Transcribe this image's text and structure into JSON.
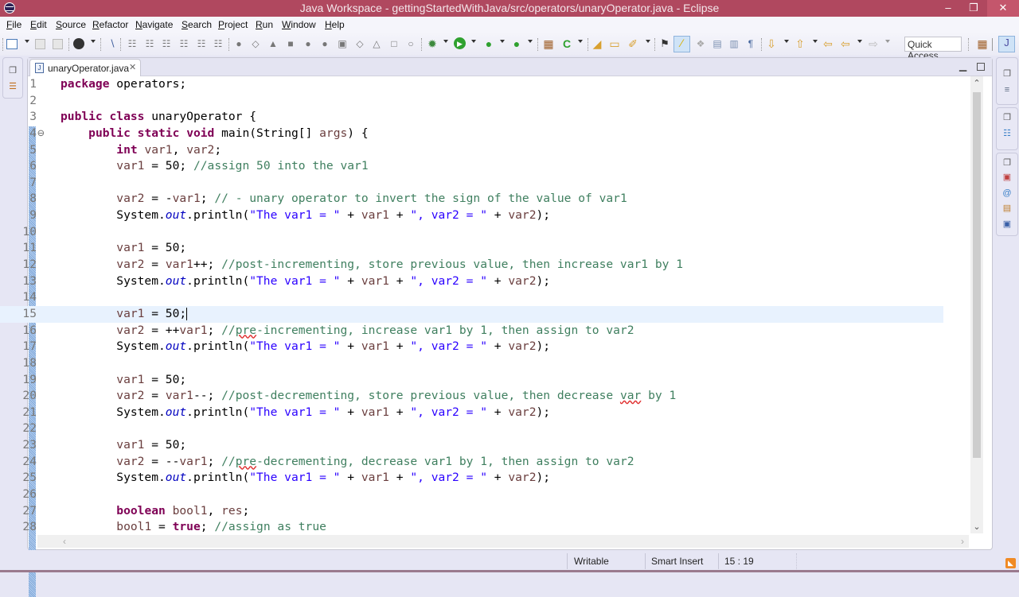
{
  "window": {
    "title": "Java Workspace - gettingStartedWithJava/src/operators/unaryOperator.java - Eclipse",
    "controls": {
      "minimize": "–",
      "maximize": "❐",
      "close": "✕"
    }
  },
  "menubar": {
    "items": [
      "File",
      "Edit",
      "Source",
      "Refactor",
      "Navigate",
      "Search",
      "Project",
      "Run",
      "Window",
      "Help"
    ]
  },
  "toolbar": {
    "quick_access_label": "Quick Access",
    "icons": [
      "new-wizard-icon",
      "save-icon",
      "save-all-icon",
      "profile-icon",
      "skip-breakpoints-icon",
      "debug-step-icons",
      "debug-icon",
      "run-icon",
      "coverage-icon",
      "external-tools-icon",
      "new-java-project-icon",
      "new-class-icon",
      "open-type-icon",
      "open-task-icon",
      "search-icon",
      "toggle-mark-occurrences-icon",
      "toggle-highlight-icon",
      "block-selection-icon",
      "show-whitespace-icon",
      "next-annotation-icon",
      "previous-annotation-icon",
      "back-icon",
      "forward-icon",
      "open-perspective-icon",
      "java-perspective-icon"
    ]
  },
  "editor": {
    "tab": {
      "label": "unaryOperator.java",
      "close": "✕"
    },
    "cursor_position": "15 : 19",
    "current_line": 15,
    "lines": [
      {
        "n": "1",
        "tokens": [
          [
            "kw",
            "package"
          ],
          [
            "nm",
            " operators;"
          ]
        ]
      },
      {
        "n": "2",
        "tokens": []
      },
      {
        "n": "3",
        "tokens": [
          [
            "kw",
            "public"
          ],
          [
            "nm",
            " "
          ],
          [
            "kw",
            "class"
          ],
          [
            "nm",
            " unaryOperator {"
          ]
        ]
      },
      {
        "n": "4",
        "fold": "⊖",
        "tokens": [
          [
            "nm",
            "    "
          ],
          [
            "kw",
            "public"
          ],
          [
            "nm",
            " "
          ],
          [
            "kw",
            "static"
          ],
          [
            "nm",
            " "
          ],
          [
            "kw",
            "void"
          ],
          [
            "nm",
            " main(String[] "
          ],
          [
            "vr",
            "args"
          ],
          [
            "nm",
            ") {"
          ]
        ]
      },
      {
        "n": "5",
        "tokens": [
          [
            "nm",
            "        "
          ],
          [
            "kw",
            "int"
          ],
          [
            "nm",
            " "
          ],
          [
            "vr",
            "var1"
          ],
          [
            "nm",
            ", "
          ],
          [
            "vr",
            "var2"
          ],
          [
            "nm",
            ";"
          ]
        ]
      },
      {
        "n": "6",
        "tokens": [
          [
            "nm",
            "        "
          ],
          [
            "vr",
            "var1"
          ],
          [
            "nm",
            " = 50; "
          ],
          [
            "cm",
            "//assign 50 into the var1"
          ]
        ]
      },
      {
        "n": "7",
        "tokens": []
      },
      {
        "n": "8",
        "tokens": [
          [
            "nm",
            "        "
          ],
          [
            "vr",
            "var2"
          ],
          [
            "nm",
            " = -"
          ],
          [
            "vr",
            "var1"
          ],
          [
            "nm",
            "; "
          ],
          [
            "cm",
            "// - unary operator to invert the sign of the value of var1"
          ]
        ]
      },
      {
        "n": "9",
        "tokens": [
          [
            "nm",
            "        System."
          ],
          [
            "fld",
            "out"
          ],
          [
            "nm",
            ".println("
          ],
          [
            "st",
            "\"The var1 = \""
          ],
          [
            "nm",
            " + "
          ],
          [
            "vr",
            "var1"
          ],
          [
            "nm",
            " + "
          ],
          [
            "st",
            "\", var2 = \""
          ],
          [
            "nm",
            " + "
          ],
          [
            "vr",
            "var2"
          ],
          [
            "nm",
            ");"
          ]
        ]
      },
      {
        "n": "10",
        "tokens": []
      },
      {
        "n": "11",
        "tokens": [
          [
            "nm",
            "        "
          ],
          [
            "vr",
            "var1"
          ],
          [
            "nm",
            " = 50;"
          ]
        ]
      },
      {
        "n": "12",
        "tokens": [
          [
            "nm",
            "        "
          ],
          [
            "vr",
            "var2"
          ],
          [
            "nm",
            " = "
          ],
          [
            "vr",
            "var1"
          ],
          [
            "nm",
            "++; "
          ],
          [
            "cm",
            "//post-incrementing, store previous value, then increase var1 by 1"
          ]
        ]
      },
      {
        "n": "13",
        "tokens": [
          [
            "nm",
            "        System."
          ],
          [
            "fld",
            "out"
          ],
          [
            "nm",
            ".println("
          ],
          [
            "st",
            "\"The var1 = \""
          ],
          [
            "nm",
            " + "
          ],
          [
            "vr",
            "var1"
          ],
          [
            "nm",
            " + "
          ],
          [
            "st",
            "\", var2 = \""
          ],
          [
            "nm",
            " + "
          ],
          [
            "vr",
            "var2"
          ],
          [
            "nm",
            ");"
          ]
        ]
      },
      {
        "n": "14",
        "tokens": []
      },
      {
        "n": "15",
        "tokens": [
          [
            "nm",
            "        "
          ],
          [
            "vr",
            "var1"
          ],
          [
            "nm",
            " = 50;"
          ]
        ]
      },
      {
        "n": "16",
        "tokens": [
          [
            "nm",
            "        "
          ],
          [
            "vr",
            "var2"
          ],
          [
            "nm",
            " = ++"
          ],
          [
            "vr",
            "var1"
          ],
          [
            "nm",
            "; "
          ],
          [
            "cm",
            "//"
          ],
          [
            "cm sq",
            "pre"
          ],
          [
            "cm",
            "-incrementing, increase var1 by 1, then assign to var2"
          ]
        ]
      },
      {
        "n": "17",
        "tokens": [
          [
            "nm",
            "        System."
          ],
          [
            "fld",
            "out"
          ],
          [
            "nm",
            ".println("
          ],
          [
            "st",
            "\"The var1 = \""
          ],
          [
            "nm",
            " + "
          ],
          [
            "vr",
            "var1"
          ],
          [
            "nm",
            " + "
          ],
          [
            "st",
            "\", var2 = \""
          ],
          [
            "nm",
            " + "
          ],
          [
            "vr",
            "var2"
          ],
          [
            "nm",
            ");"
          ]
        ]
      },
      {
        "n": "18",
        "tokens": []
      },
      {
        "n": "19",
        "tokens": [
          [
            "nm",
            "        "
          ],
          [
            "vr",
            "var1"
          ],
          [
            "nm",
            " = 50;"
          ]
        ]
      },
      {
        "n": "20",
        "tokens": [
          [
            "nm",
            "        "
          ],
          [
            "vr",
            "var2"
          ],
          [
            "nm",
            " = "
          ],
          [
            "vr",
            "var1"
          ],
          [
            "nm",
            "--; "
          ],
          [
            "cm",
            "//post-decrementing, store previous value, then decrease "
          ],
          [
            "cm sq",
            "var"
          ],
          [
            "cm",
            " by 1"
          ]
        ]
      },
      {
        "n": "21",
        "tokens": [
          [
            "nm",
            "        System."
          ],
          [
            "fld",
            "out"
          ],
          [
            "nm",
            ".println("
          ],
          [
            "st",
            "\"The var1 = \""
          ],
          [
            "nm",
            " + "
          ],
          [
            "vr",
            "var1"
          ],
          [
            "nm",
            " + "
          ],
          [
            "st",
            "\", var2 = \""
          ],
          [
            "nm",
            " + "
          ],
          [
            "vr",
            "var2"
          ],
          [
            "nm",
            ");"
          ]
        ]
      },
      {
        "n": "22",
        "tokens": []
      },
      {
        "n": "23",
        "tokens": [
          [
            "nm",
            "        "
          ],
          [
            "vr",
            "var1"
          ],
          [
            "nm",
            " = 50;"
          ]
        ]
      },
      {
        "n": "24",
        "tokens": [
          [
            "nm",
            "        "
          ],
          [
            "vr",
            "var2"
          ],
          [
            "nm",
            " = --"
          ],
          [
            "vr",
            "var1"
          ],
          [
            "nm",
            "; "
          ],
          [
            "cm",
            "//"
          ],
          [
            "cm sq",
            "pre"
          ],
          [
            "cm",
            "-decrementing, decrease var1 by 1, then assign to var2"
          ]
        ]
      },
      {
        "n": "25",
        "tokens": [
          [
            "nm",
            "        System."
          ],
          [
            "fld",
            "out"
          ],
          [
            "nm",
            ".println("
          ],
          [
            "st",
            "\"The var1 = \""
          ],
          [
            "nm",
            " + "
          ],
          [
            "vr",
            "var1"
          ],
          [
            "nm",
            " + "
          ],
          [
            "st",
            "\", var2 = \""
          ],
          [
            "nm",
            " + "
          ],
          [
            "vr",
            "var2"
          ],
          [
            "nm",
            ");"
          ]
        ]
      },
      {
        "n": "26",
        "tokens": []
      },
      {
        "n": "27",
        "tokens": [
          [
            "nm",
            "        "
          ],
          [
            "kw",
            "boolean"
          ],
          [
            "nm",
            " "
          ],
          [
            "vr",
            "bool1"
          ],
          [
            "nm",
            ", "
          ],
          [
            "vr",
            "res"
          ],
          [
            "nm",
            ";"
          ]
        ]
      },
      {
        "n": "28",
        "tokens": [
          [
            "nm",
            "        "
          ],
          [
            "vr",
            "bool1"
          ],
          [
            "nm",
            " = "
          ],
          [
            "kw",
            "true"
          ],
          [
            "nm",
            "; "
          ],
          [
            "cm",
            "//assign as true"
          ]
        ]
      }
    ]
  },
  "statusbar": {
    "writable": "Writable",
    "insert_mode": "Smart Insert",
    "position": "15 : 19"
  }
}
